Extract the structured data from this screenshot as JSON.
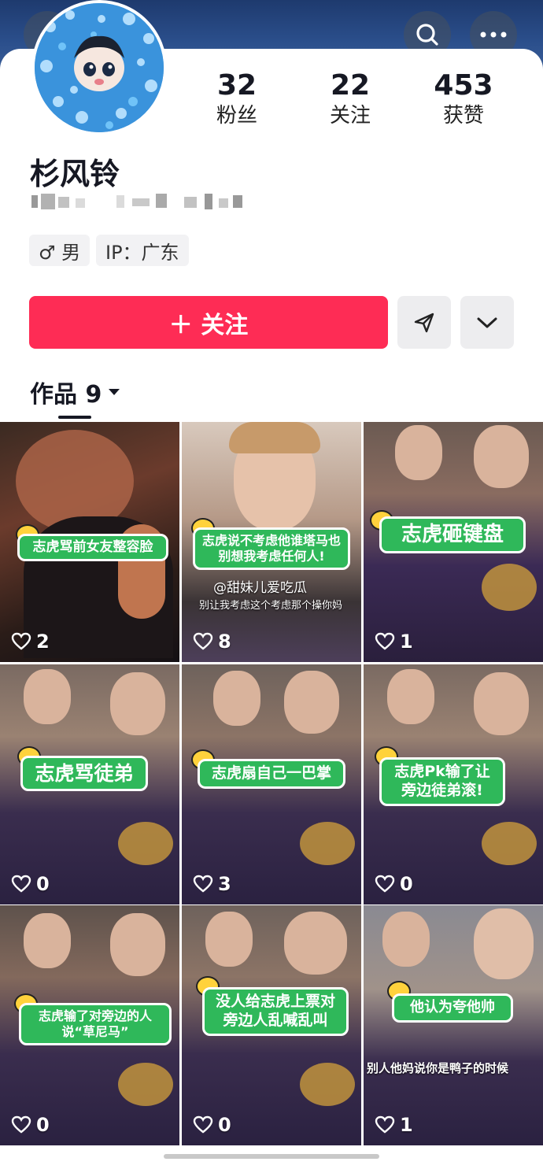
{
  "profile": {
    "name": "杉风铃",
    "stats": [
      {
        "value": "32",
        "label": "粉丝"
      },
      {
        "value": "22",
        "label": "关注"
      },
      {
        "value": "453",
        "label": "获赞"
      }
    ],
    "tags": [
      "♂ 男",
      "IP：广东"
    ],
    "follow_label": "＋ 关注"
  },
  "tabs": {
    "works_label": "作品 9"
  },
  "videos": [
    {
      "caption": "志虎骂前女友整容脸",
      "likes": "2"
    },
    {
      "caption": "志虎说不考虑他谁塔马也别想我考虑任何人!",
      "likes": "8",
      "watermark": "@甜妹儿爱吃瓜",
      "subtitle": "别让我考虑这个考虑那个操你妈"
    },
    {
      "caption": "志虎砸键盘",
      "likes": "1"
    },
    {
      "caption": "志虎骂徒弟",
      "likes": "0"
    },
    {
      "caption": "志虎扇自己一巴掌",
      "likes": "3"
    },
    {
      "caption": "志虎Pk输了让旁边徒弟滚!",
      "likes": "0"
    },
    {
      "caption": "志虎输了对旁边的人说“草尼马”",
      "likes": "0"
    },
    {
      "caption": "没人给志虎上票对旁边人乱喊乱叫",
      "likes": "0"
    },
    {
      "caption": "他认为夸他帅",
      "likes": "1",
      "subtitle": "别人他妈说你是鸭子的时候"
    }
  ],
  "colors": {
    "accent": "#fe2c55",
    "caption_bg": "#2fb85a"
  }
}
